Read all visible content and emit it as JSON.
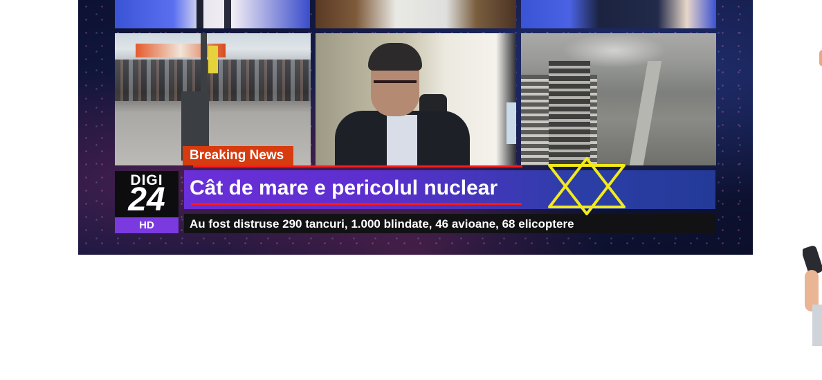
{
  "broadcast": {
    "breaking_label": "Breaking News",
    "headline": "Cât de mare e pericolul nuclear",
    "ticker": "Au fost distruse 290 tancuri, 1.000 blindate, 46 avioane, 68 elicoptere",
    "logo": {
      "top": "DIGI",
      "number": "24",
      "badge": "HD"
    }
  },
  "colors": {
    "breaking_bg": "#d63c10",
    "headline_bg": "#6a2fd8",
    "hd_badge": "#7a3ae0",
    "annotation_red": "#ff1a1a",
    "annotation_yellow": "#f2ea1b"
  },
  "annotations": {
    "star_icon": "star-of-david-icon"
  }
}
